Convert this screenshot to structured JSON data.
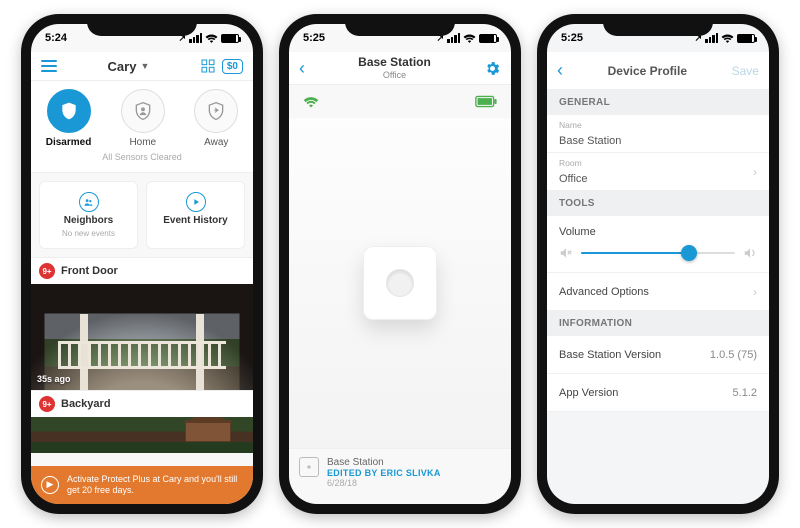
{
  "status_time": "5:24",
  "status_time2": "5:25",
  "status_time3": "5:25",
  "loc_arrow": "↗",
  "p1": {
    "location": "Cary",
    "balance": "$0",
    "modes": {
      "disarmed": "Disarmed",
      "home": "Home",
      "away": "Away"
    },
    "sensors": "All Sensors Cleared",
    "neighbors": {
      "title": "Neighbors",
      "sub": "No new events"
    },
    "history": {
      "title": "Event History"
    },
    "cams": {
      "front": {
        "name": "Front Door",
        "badge": "9+",
        "time": "35s ago"
      },
      "back": {
        "name": "Backyard",
        "badge": "9+"
      }
    },
    "banner": {
      "line1": "Activate Protect Plus at Cary and you'll still",
      "line2": "get 20 free days."
    }
  },
  "p2": {
    "title": "Base Station",
    "subtitle": "Office",
    "footer": {
      "name": "Base Station",
      "edited": "EDITED BY ERIC SLIVKA",
      "date": "6/28/18"
    }
  },
  "p3": {
    "title": "Device Profile",
    "save": "Save",
    "sections": {
      "general": "GENERAL",
      "tools": "TOOLS",
      "info": "INFORMATION"
    },
    "general": {
      "name_k": "Name",
      "name_v": "Base Station",
      "room_k": "Room",
      "room_v": "Office"
    },
    "tools": {
      "volume": "Volume",
      "advanced": "Advanced Options"
    },
    "info": {
      "bs_k": "Base Station Version",
      "bs_v": "1.0.5 (75)",
      "app_k": "App Version",
      "app_v": "5.1.2"
    }
  }
}
